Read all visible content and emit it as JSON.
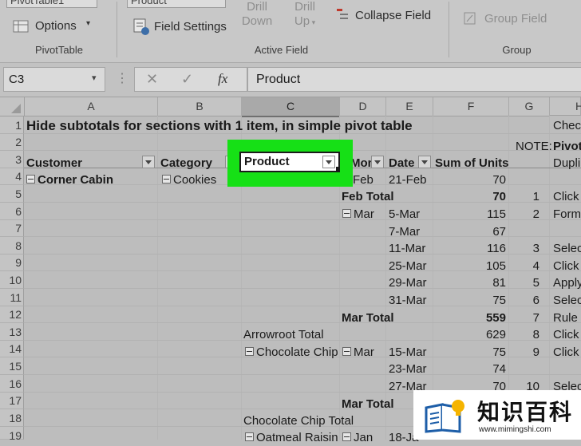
{
  "ribbon": {
    "pivot_name": "PivotTable1",
    "options_label": "Options",
    "pivottable_group": "PivotTable",
    "active_field_value": "Product",
    "field_settings_label": "Field Settings",
    "drill_down_label": [
      "Drill",
      "Down"
    ],
    "drill_up_label": [
      "Drill",
      "Up"
    ],
    "collapse_field_label": "Collapse Field",
    "active_field_group": "Active Field",
    "group_field_label": "Group Field",
    "group_group": "Group"
  },
  "formula_bar": {
    "name_box": "C3",
    "fx_symbol": "fx",
    "content": "Product"
  },
  "columns": [
    "A",
    "B",
    "C",
    "D",
    "E",
    "F",
    "G",
    "H"
  ],
  "rows": [
    "1",
    "2",
    "3",
    "4",
    "5",
    "6",
    "7",
    "8",
    "9",
    "10",
    "11",
    "12",
    "13",
    "14",
    "15",
    "16",
    "17",
    "18",
    "19"
  ],
  "sheet": {
    "title": "Hide subtotals for sections with 1 item, in simple pivot table",
    "headers": {
      "customer": "Customer",
      "category": "Category",
      "product": "Product",
      "month": "Mont",
      "date": "Date",
      "sum": "Sum of Units"
    },
    "customer_a4": "Corner Cabin",
    "category_b4": "Cookies",
    "month_d4": "Feb",
    "feb_total": "Feb Total",
    "mar_d6": "Mar",
    "mar_total": "Mar Total",
    "arrowroot_total": "Arrowroot Total",
    "chocolate_chip": "Chocolate Chip",
    "mar_d14": "Mar",
    "mar_total_17": "Mar Total",
    "chocolate_chip_total": "Chocolate Chip Total",
    "oatmeal_raisin": "Oatmeal Raisin",
    "jan_d19": "Jan",
    "dates": {
      "e4": "21-Feb",
      "e6": "5-Mar",
      "e7": "7-Mar",
      "e8": "11-Mar",
      "e9": "25-Mar",
      "e10": "29-Mar",
      "e11": "31-Mar",
      "e14": "15-Mar",
      "e15": "23-Mar",
      "e16": "27-Mar",
      "e19": "18-Ja"
    },
    "values": {
      "f4": "70",
      "f5": "70",
      "f6": "115",
      "f7": "67",
      "f8": "116",
      "f9": "105",
      "f10": "81",
      "f11": "75",
      "f12": "559",
      "f13": "629",
      "f14": "75",
      "f15": "74",
      "f16": "70"
    },
    "g_col": {
      "g3": "NOTE:",
      "g5": "1",
      "g6": "2",
      "g8": "3",
      "g9": "4",
      "g10": "5",
      "g11": "6",
      "g12": "7",
      "g13": "8",
      "g14": "9",
      "g16": "10"
    },
    "h_col": {
      "h1": "Chec",
      "h3": "Pivot",
      "h3b": "Dupli",
      "h5": "Click",
      "h6": "Form",
      "h8": "Selec",
      "h9": "Click",
      "h10": "Apply",
      "h11": "Selec",
      "h12": "Rule",
      "h13": "Click",
      "h14": "Click",
      "h16": "Selec"
    }
  },
  "watermark": {
    "title": "知识百科",
    "url": "www.mimingshi.com"
  },
  "colors": {
    "highlight": "#16e016",
    "cell_selection": "#ffffff"
  }
}
